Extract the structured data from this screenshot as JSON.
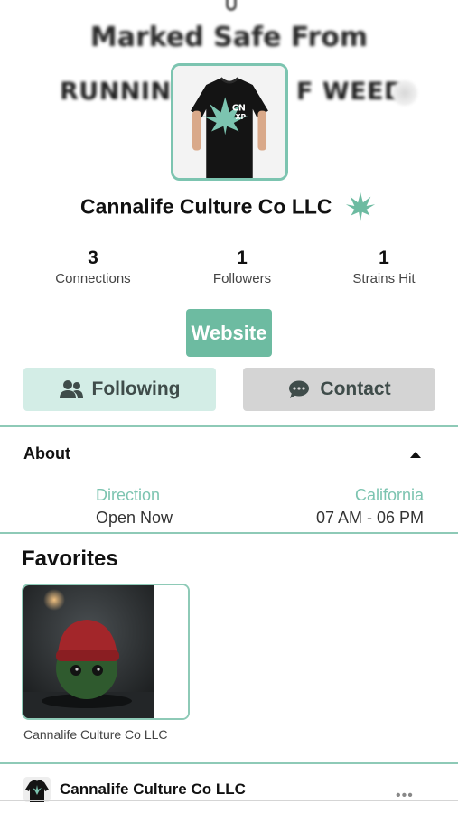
{
  "cover": {
    "line1": "Marked Safe From",
    "line2_left": "RUNNIN",
    "line2_right": "F WEED"
  },
  "profile": {
    "name": "Cannalife Culture Co LLC"
  },
  "stats": [
    {
      "value": "3",
      "label": "Connections"
    },
    {
      "value": "1",
      "label": "Followers"
    },
    {
      "value": "1",
      "label": "Strains Hit"
    }
  ],
  "buttons": {
    "website": "Website",
    "following": "Following",
    "contact": "Contact"
  },
  "about": {
    "title": "About",
    "direction_label": "Direction",
    "status_value": "Open Now",
    "location_label": "California",
    "hours_value": "07 AM - 06 PM"
  },
  "favorites": {
    "title": "Favorites",
    "items": [
      {
        "caption": "Cannalife Culture Co LLC"
      }
    ]
  },
  "post": {
    "author": "Cannalife Culture Co LLC",
    "more": "•••"
  },
  "colors": {
    "accent": "#6dbba1",
    "accent_light": "#d3ede6",
    "border": "#8ecab7",
    "contact_bg": "#d4d4d4"
  },
  "icons": [
    "leaf-icon",
    "users-icon",
    "chat-icon",
    "caret-up-icon",
    "more-icon"
  ]
}
